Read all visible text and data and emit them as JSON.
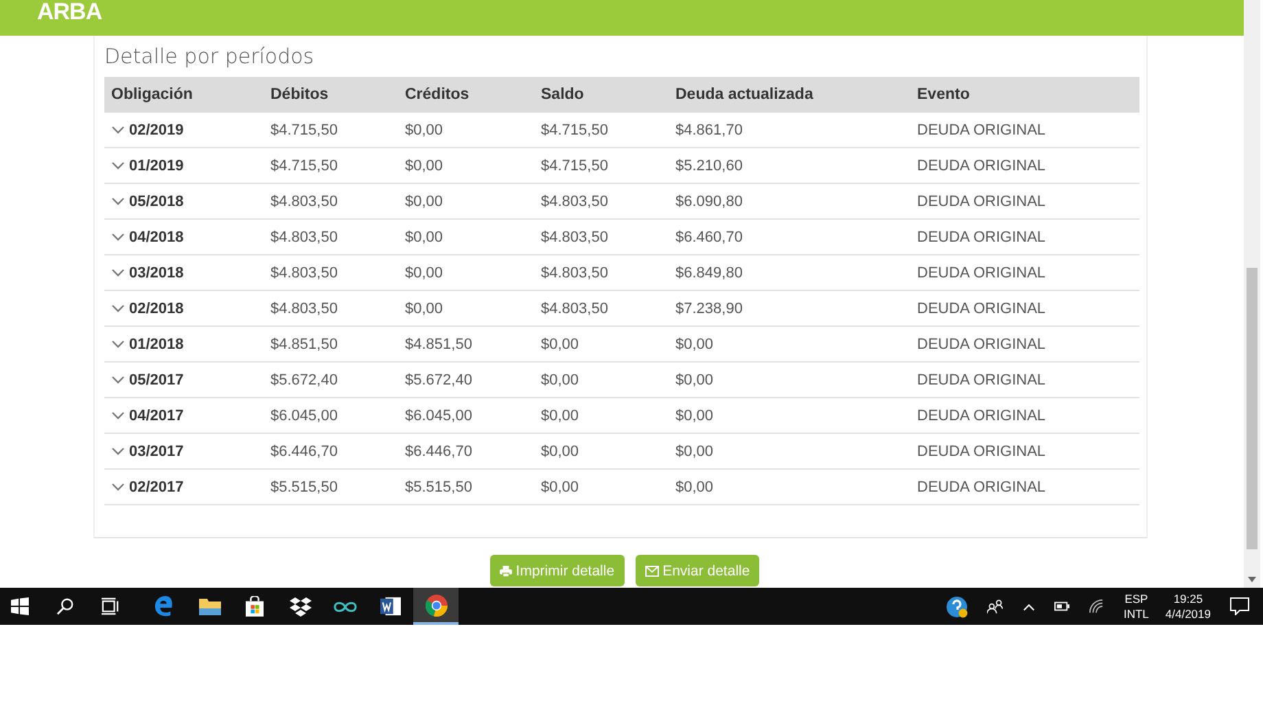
{
  "header": {
    "logo": "ARBA"
  },
  "section_title": "Detalle por períodos",
  "table": {
    "columns": [
      "Obligación",
      "Débitos",
      "Créditos",
      "Saldo",
      "Deuda actualizada",
      "Evento"
    ],
    "rows": [
      {
        "expanded": false,
        "cells": [
          "02/2019",
          "$4.715,50",
          "$0,00",
          "$4.715,50",
          "$4.861,70",
          "DEUDA ORIGINAL"
        ]
      },
      {
        "expanded": false,
        "cells": [
          "01/2019",
          "$4.715,50",
          "$0,00",
          "$4.715,50",
          "$5.210,60",
          "DEUDA ORIGINAL"
        ]
      },
      {
        "expanded": false,
        "cells": [
          "05/2018",
          "$4.803,50",
          "$0,00",
          "$4.803,50",
          "$6.090,80",
          "DEUDA ORIGINAL"
        ]
      },
      {
        "expanded": false,
        "cells": [
          "04/2018",
          "$4.803,50",
          "$0,00",
          "$4.803,50",
          "$6.460,70",
          "DEUDA ORIGINAL"
        ]
      },
      {
        "expanded": false,
        "cells": [
          "03/2018",
          "$4.803,50",
          "$0,00",
          "$4.803,50",
          "$6.849,80",
          "DEUDA ORIGINAL"
        ]
      },
      {
        "expanded": false,
        "cells": [
          "02/2018",
          "$4.803,50",
          "$0,00",
          "$4.803,50",
          "$7.238,90",
          "DEUDA ORIGINAL"
        ]
      },
      {
        "expanded": false,
        "cells": [
          "01/2018",
          "$4.851,50",
          "$4.851,50",
          "$0,00",
          "$0,00",
          "DEUDA ORIGINAL"
        ]
      },
      {
        "expanded": false,
        "cells": [
          "05/2017",
          "$5.672,40",
          "$5.672,40",
          "$0,00",
          "$0,00",
          "DEUDA ORIGINAL"
        ]
      },
      {
        "expanded": false,
        "cells": [
          "04/2017",
          "$6.045,00",
          "$6.045,00",
          "$0,00",
          "$0,00",
          "DEUDA ORIGINAL"
        ]
      },
      {
        "expanded": false,
        "cells": [
          "03/2017",
          "$6.446,70",
          "$6.446,70",
          "$0,00",
          "$0,00",
          "DEUDA ORIGINAL"
        ]
      },
      {
        "expanded": false,
        "cells": [
          "02/2017",
          "$5.515,50",
          "$5.515,50",
          "$0,00",
          "$0,00",
          "DEUDA ORIGINAL"
        ]
      }
    ]
  },
  "buttons": [
    {
      "kind": "print",
      "label": "Imprimir detalle"
    },
    {
      "kind": "mail",
      "label": "Enviar detalle"
    }
  ],
  "taskbar": {
    "apps": [
      {
        "kind": "edge",
        "selected": false
      },
      {
        "kind": "folder",
        "selected": false
      },
      {
        "kind": "store",
        "selected": false
      },
      {
        "kind": "dropbox",
        "selected": false
      },
      {
        "kind": "infinity",
        "selected": false
      },
      {
        "kind": "word",
        "selected": false
      },
      {
        "kind": "chrome",
        "selected": true
      }
    ],
    "language": "ESP",
    "layout": "INTL",
    "time": "19:25",
    "date": "4/4/2019"
  }
}
